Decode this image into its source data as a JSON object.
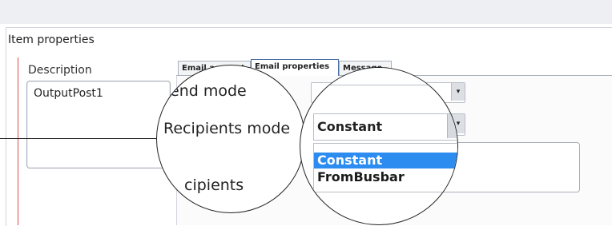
{
  "panel": {
    "title": "Item properties",
    "description_label": "Description",
    "description_value": "OutputPost1"
  },
  "tabs": [
    {
      "label": "Email account",
      "active": false
    },
    {
      "label": "Email properties",
      "active": true
    },
    {
      "label": "Message",
      "active": false
    }
  ],
  "fields": {
    "send_mode_label": "end mode",
    "recipients_mode_label": "Recipients mode",
    "recipients_label": "cipients",
    "selected_mode": "Constant"
  },
  "dropdown": {
    "options": [
      "Constant",
      "FromBusbar"
    ],
    "highlighted": "Constant"
  },
  "icons": {
    "dropdown_arrow": "▾"
  },
  "colors": {
    "selection": "#2d8cf0",
    "required_marker": "#d94b4b"
  }
}
